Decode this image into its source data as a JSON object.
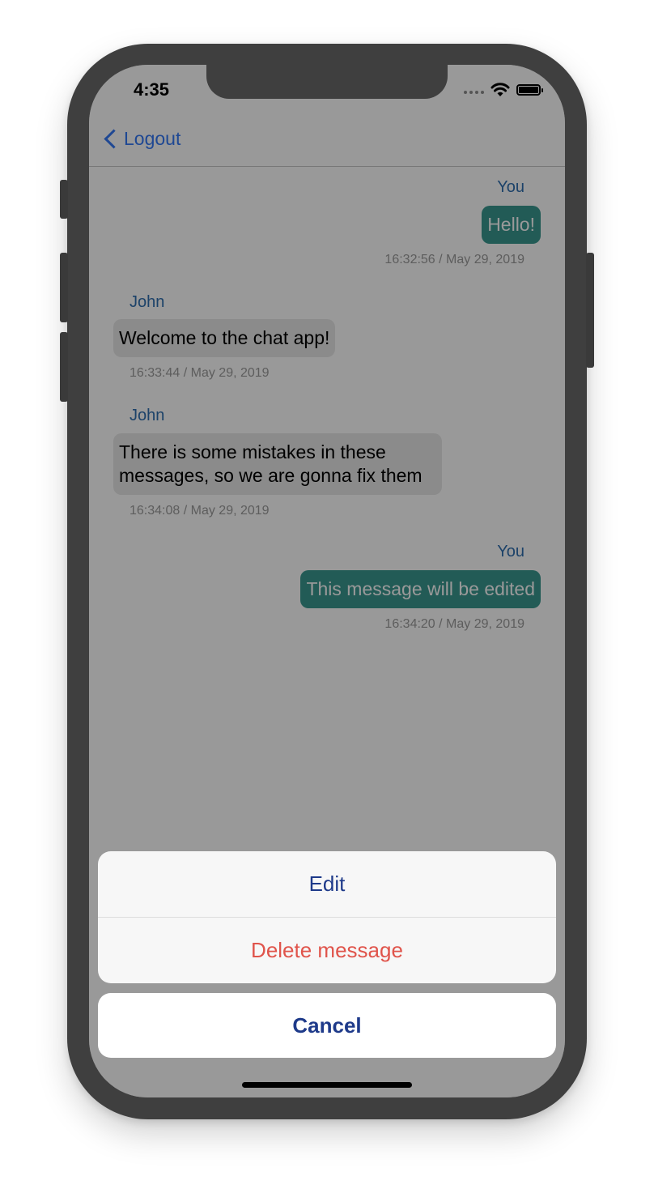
{
  "status_bar": {
    "time": "4:35"
  },
  "nav": {
    "back_label": "Logout"
  },
  "messages": [
    {
      "author": "You",
      "text": "Hello!",
      "timestamp": "16:32:56 / May 29, 2019",
      "own": true
    },
    {
      "author": "John",
      "text": "Welcome to the chat app!",
      "timestamp": "16:33:44 / May 29, 2019",
      "own": false
    },
    {
      "author": "John",
      "text_line1": "There is some mistakes in these",
      "text_line2": "messages, so we are gonna fix them",
      "timestamp": "16:34:08 / May 29, 2019",
      "own": false
    },
    {
      "author": "You",
      "text": "This message will be edited",
      "timestamp": "16:34:20 / May 29, 2019",
      "own": true
    }
  ],
  "action_sheet": {
    "edit_label": "Edit",
    "delete_label": "Delete message",
    "cancel_label": "Cancel"
  },
  "colors": {
    "own_bubble": "#3a9890",
    "other_bubble": "#e8e8e8",
    "author": "#2f6fb0",
    "action_default": "#1e3a8a",
    "action_destructive": "#e0544b"
  },
  "icons": [
    "back-chevron-icon",
    "signal-icon",
    "wifi-icon",
    "battery-icon"
  ]
}
